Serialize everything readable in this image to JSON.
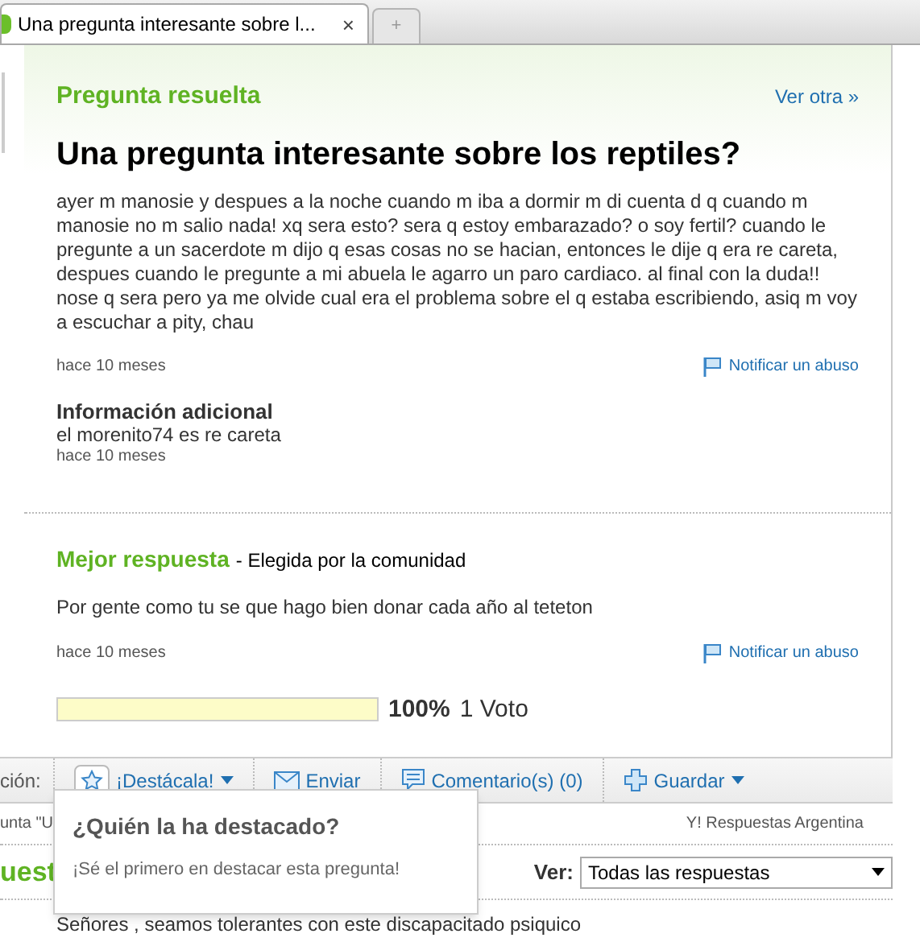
{
  "browser_tabs": [
    {
      "title": "Una pregunta interesante sobre l...",
      "close": "×",
      "selected": true
    }
  ],
  "new_tab": "+",
  "question": {
    "status": "Pregunta resuelta",
    "other_link": "Ver otra »",
    "title": "Una pregunta interesante sobre los reptiles?",
    "body": "ayer m manosie y despues a la noche cuando m iba a dormir m di cuenta d q cuando m manosie no m salio nada! xq sera esto? sera q estoy embarazado? o soy fertil? cuando le pregunte a un sacerdote m dijo q esas cosas no se hacian, entonces le dije q era re careta, despues cuando le pregunte a mi abuela le agarro un paro cardiaco. al final con la duda!! nose q sera pero ya me olvide cual era el problema sobre el q estaba escribiendo, asiq m voy a escuchar a pity, chau",
    "time": "hace 10 meses",
    "report": "Notificar un abuso",
    "additional_title": "Información adicional",
    "additional_text": "el morenito74 es re careta",
    "additional_time": "hace 10 meses"
  },
  "best_answer": {
    "heading": "Mejor respuesta",
    "subheading": "- Elegida por la comunidad",
    "text": "Por gente como tu se que hago bien donar cada año al teteton",
    "time": "hace 10 meses",
    "report": "Notificar un abuso",
    "level": 1,
    "percent": "100%",
    "votes": "1 Voto"
  },
  "actions": {
    "label": "ción:",
    "items": [
      {
        "kind": "star",
        "label": "¡Destácala!",
        "menu": true
      },
      {
        "kind": "mail",
        "label": "Enviar",
        "menu": false
      },
      {
        "kind": "comment",
        "label": "Comentario(s) (0)",
        "menu": false
      },
      {
        "kind": "plus",
        "label": "Guardar",
        "menu": true
      }
    ]
  },
  "breadcrumb": {
    "start": "unta \"U",
    "end": "Y! Respuestas Argentina"
  },
  "popup": {
    "title": "¿Quién la ha destacado?",
    "text": "¡Sé el primero en destacar esta pregunta!"
  },
  "answers": {
    "heading": "uest",
    "filter_label": "Ver:",
    "filter_value": "Todas las respuestas",
    "first_answer": "Señores , seamos tolerantes con este discapacitado psiquico"
  }
}
